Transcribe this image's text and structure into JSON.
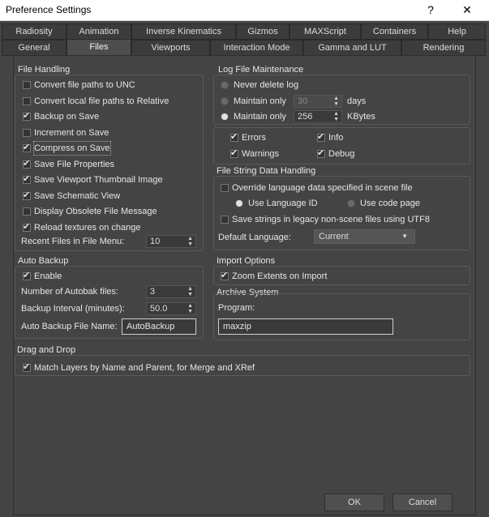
{
  "window": {
    "title": "Preference Settings",
    "help_glyph": "?",
    "close_glyph": "✕"
  },
  "tabs_row1": [
    "Radiosity",
    "Animation",
    "Inverse Kinematics",
    "Gizmos",
    "MAXScript",
    "Containers",
    "Help"
  ],
  "tabs_row2": [
    "General",
    "Files",
    "Viewports",
    "Interaction Mode",
    "Gamma and LUT",
    "Rendering"
  ],
  "file_handling": {
    "title": "File Handling",
    "options": [
      {
        "label": "Convert file paths to UNC",
        "checked": false
      },
      {
        "label": "Convert local file paths to Relative",
        "checked": false
      },
      {
        "label": "Backup on Save",
        "checked": true
      },
      {
        "label": "Increment on Save",
        "checked": false
      },
      {
        "label": "Compress on Save",
        "checked": true
      },
      {
        "label": "Save File Properties",
        "checked": true
      },
      {
        "label": "Save Viewport Thumbnail Image",
        "checked": true
      },
      {
        "label": "Save Schematic View",
        "checked": true
      },
      {
        "label": "Display Obsolete File Message",
        "checked": false
      },
      {
        "label": "Reload textures on change",
        "checked": true
      }
    ],
    "recent_label": "Recent Files in File Menu:",
    "recent_value": "10"
  },
  "log_maintenance": {
    "title": "Log File Maintenance",
    "never_delete": "Never delete log",
    "maintain_only": "Maintain only",
    "days_value": "30",
    "days_unit": "days",
    "kbytes_value": "256",
    "kbytes_unit": "KBytes",
    "selected": "kbytes",
    "errors": "Errors",
    "info": "Info",
    "warnings": "Warnings",
    "debug": "Debug"
  },
  "string_handling": {
    "title": "File String Data Handling",
    "override": "Override language data specified in scene file",
    "use_language_id": "Use Language ID",
    "use_code_page": "Use code page",
    "save_utf8": "Save strings in legacy non-scene files using UTF8",
    "default_language_label": "Default Language:",
    "default_language_value": "Current"
  },
  "auto_backup": {
    "title": "Auto Backup",
    "enable": "Enable",
    "num_files_label": "Number of Autobak files:",
    "num_files_value": "3",
    "interval_label": "Backup Interval (minutes):",
    "interval_value": "50.0",
    "file_name_label": "Auto Backup File Name:",
    "file_name_value": "AutoBackup"
  },
  "import_options": {
    "title": "Import Options",
    "zoom_extents": "Zoom Extents on Import"
  },
  "archive_system": {
    "title": "Archive System",
    "program_label": "Program:",
    "program_value": "maxzip"
  },
  "drag_drop": {
    "title": "Drag and Drop",
    "match_layers": "Match Layers by Name and Parent, for Merge and XRef"
  },
  "buttons": {
    "ok": "OK",
    "cancel": "Cancel"
  }
}
